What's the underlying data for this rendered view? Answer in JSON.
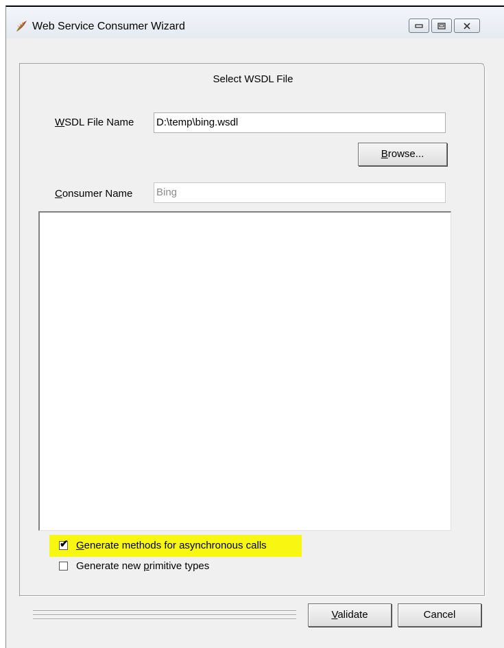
{
  "window": {
    "title": "Web Service Consumer Wizard",
    "icon": "feather-app-icon",
    "controls": [
      "minimize-icon",
      "maximize-icon",
      "close-icon"
    ]
  },
  "page": {
    "heading": "Select WSDL File"
  },
  "form": {
    "wsdl_label_access": "W",
    "wsdl_label_rest": "SDL File Name",
    "wsdl_value": "D:\\temp\\bing.wsdl",
    "browse_access": "B",
    "browse_rest": "rowse...",
    "consumer_label_access": "C",
    "consumer_label_rest": "onsumer Name",
    "consumer_value": "Bing"
  },
  "options": {
    "async_access": "G",
    "async_rest": "enerate methods for asynchronous calls",
    "async_checked": true,
    "primitive_before": "Generate new ",
    "primitive_access": "p",
    "primitive_rest": "rimitive types",
    "primitive_checked": false,
    "highlight_color": "#f7f711"
  },
  "footer": {
    "validate_access": "V",
    "validate_rest": "alidate",
    "cancel_label": "Cancel"
  }
}
